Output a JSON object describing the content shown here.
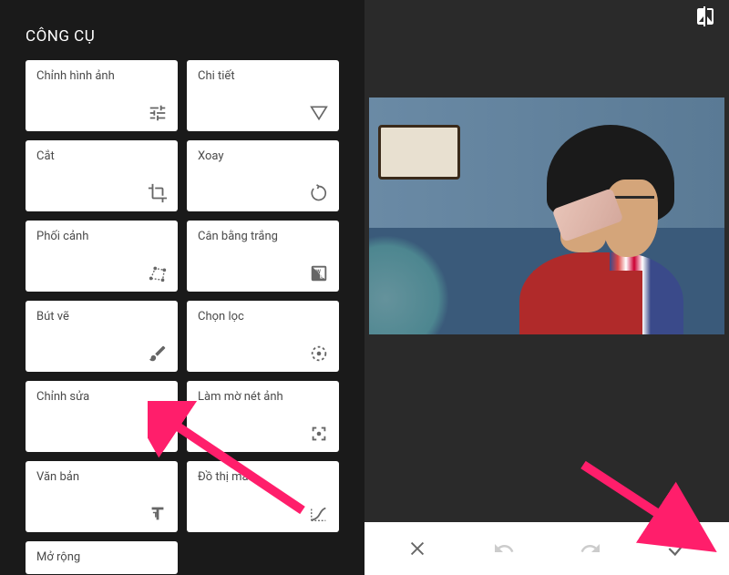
{
  "panel_title": "CÔNG CỤ",
  "tools": [
    {
      "label": "Chỉnh hình ảnh",
      "icon": "tune"
    },
    {
      "label": "Chi tiết",
      "icon": "details"
    },
    {
      "label": "Cắt",
      "icon": "crop"
    },
    {
      "label": "Xoay",
      "icon": "rotate"
    },
    {
      "label": "Phối cảnh",
      "icon": "perspective"
    },
    {
      "label": "Cân bằng trắng",
      "icon": "wb"
    },
    {
      "label": "Bút vẽ",
      "icon": "brush"
    },
    {
      "label": "Chọn lọc",
      "icon": "selective"
    },
    {
      "label": "Chỉnh sửa",
      "icon": "healing"
    },
    {
      "label": "Làm mờ nét ảnh",
      "icon": "vignette"
    },
    {
      "label": "Văn bản",
      "icon": "text"
    },
    {
      "label": "Đồ thị màu",
      "icon": "curves"
    },
    {
      "label": "Mở rộng",
      "icon": ""
    }
  ]
}
